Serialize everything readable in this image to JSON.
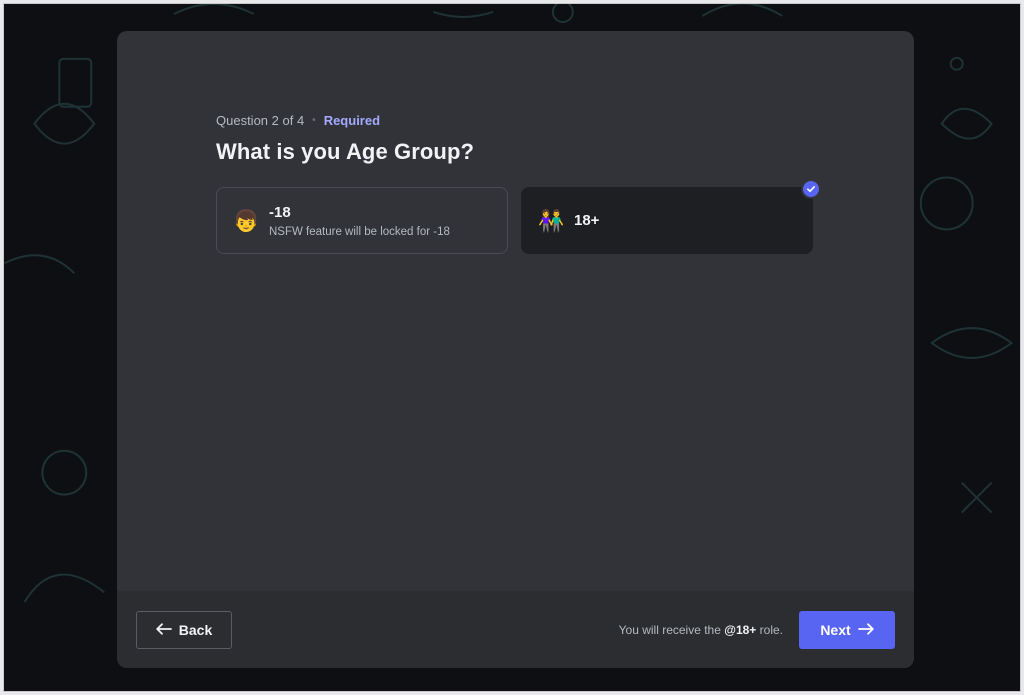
{
  "question": {
    "progress": "Question 2 of 4",
    "separator": "•",
    "required_label": "Required",
    "title": "What is you Age Group?"
  },
  "options": [
    {
      "label": "-18",
      "description": "NSFW feature will be locked for -18",
      "emoji": "👦",
      "selected": false
    },
    {
      "label": "18+",
      "description": "",
      "emoji": "👫",
      "selected": true
    }
  ],
  "footer": {
    "back_label": "Back",
    "role_note_prefix": "You will receive the",
    "role_name": "@18+",
    "role_note_suffix": "role.",
    "next_label": "Next"
  },
  "colors": {
    "accent": "#5865f2",
    "required": "#a5a9ff",
    "modal_bg": "#313338",
    "footer_bg": "#2b2d31",
    "backdrop": "#0e0f12"
  },
  "icons": {
    "back": "arrow-left-icon",
    "next": "arrow-right-icon",
    "selected": "check-icon"
  }
}
